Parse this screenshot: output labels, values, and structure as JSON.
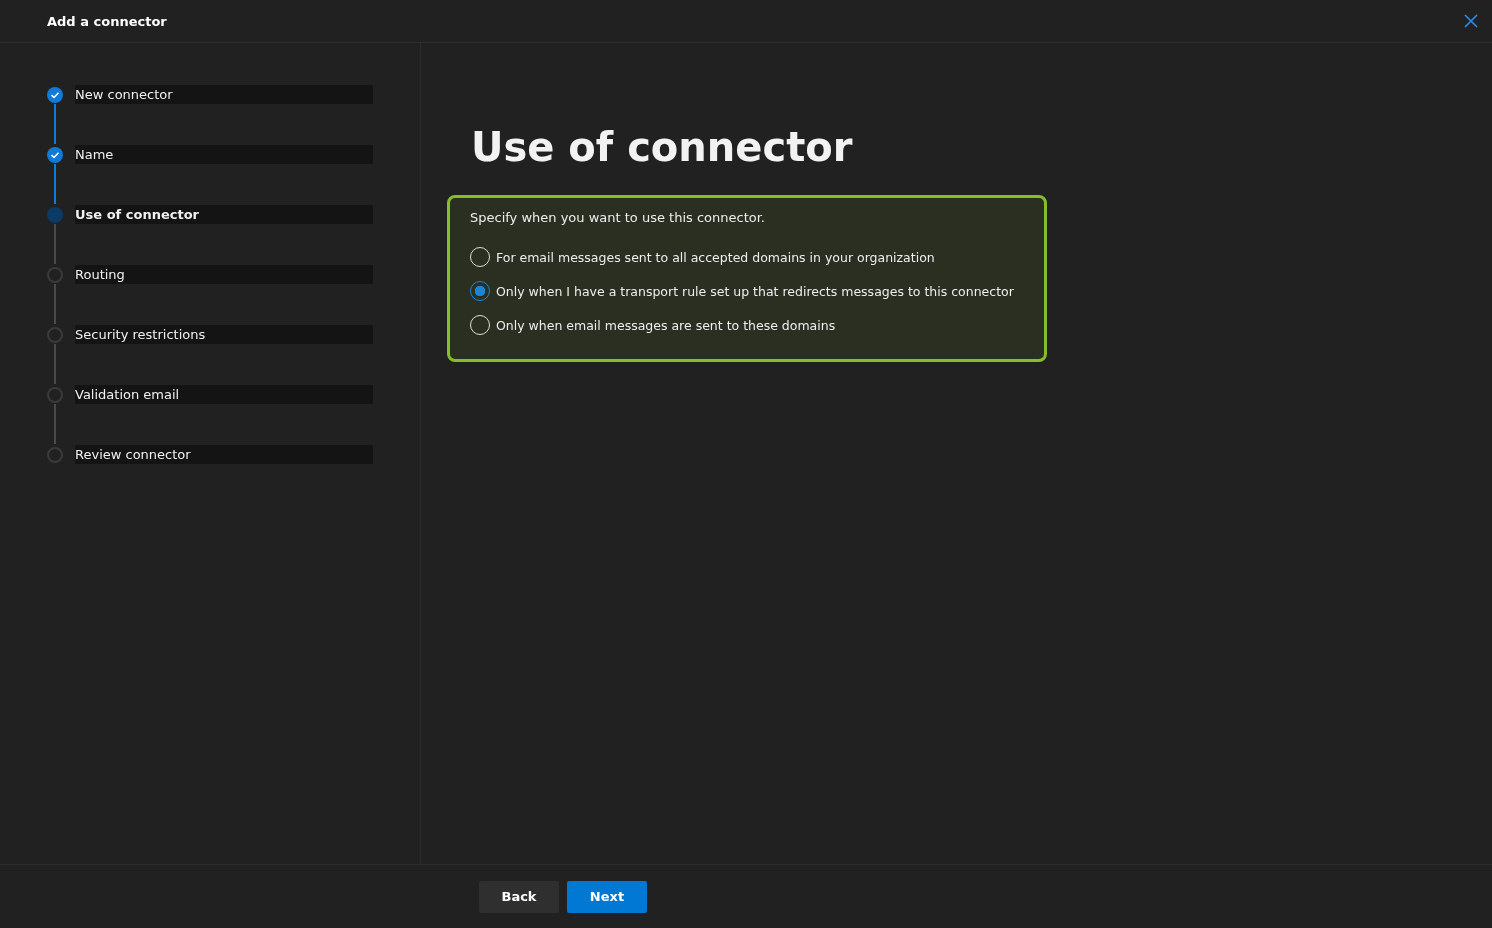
{
  "window": {
    "title": "Add a connector"
  },
  "steps": [
    {
      "label": "New connector",
      "kind": "done"
    },
    {
      "label": "Name",
      "kind": "done"
    },
    {
      "label": "Use of connector",
      "kind": "current"
    },
    {
      "label": "Routing",
      "kind": "pending"
    },
    {
      "label": "Security restrictions",
      "kind": "pending"
    },
    {
      "label": "Validation email",
      "kind": "pending"
    },
    {
      "label": "Review connector",
      "kind": "pending"
    }
  ],
  "page_title": "Use of connector",
  "options_box": {
    "prompt": "Specify when you want to use this connector.",
    "options": [
      {
        "label": "For email messages sent to all accepted domains in your organization",
        "selected": false
      },
      {
        "label": "Only when I have a transport rule set up that redirects messages to this connector",
        "selected": true
      },
      {
        "label": "Only when email messages are sent to these domains",
        "selected": false
      }
    ]
  },
  "buttons": [
    {
      "label": "Back",
      "kind": "secondary"
    },
    {
      "label": "Next",
      "kind": "primary"
    }
  ]
}
